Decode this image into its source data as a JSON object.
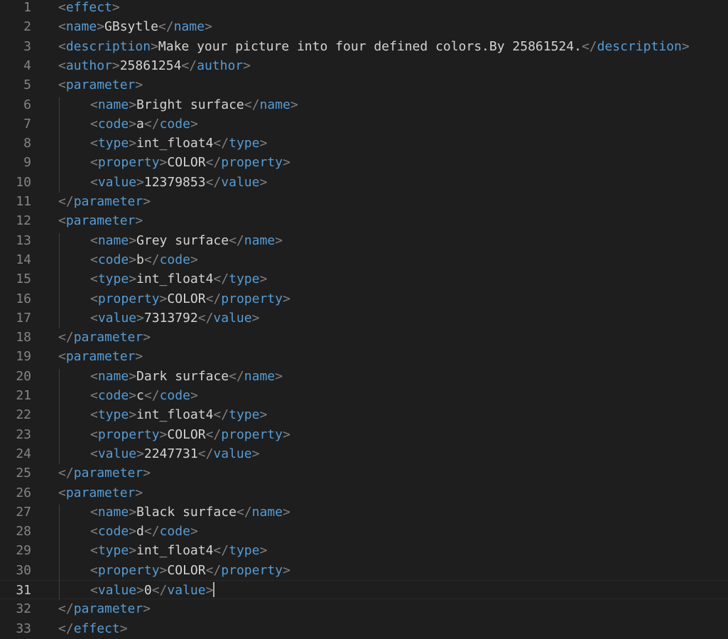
{
  "editor": {
    "language": "xml",
    "cursor_line": 31,
    "colors": {
      "background": "#1e1e1e",
      "tag": "#569cd6",
      "bracket": "#808080",
      "text": "#d4d4d4",
      "line_number": "#858585",
      "active_line_number": "#c6c6c6"
    },
    "lines": [
      {
        "n": "1",
        "indent": 0,
        "tag": "effect"
      },
      {
        "n": "2",
        "indent": 0,
        "tag": "name",
        "text": "GBsytle"
      },
      {
        "n": "3",
        "indent": 0,
        "tag": "description",
        "text": "Make your picture into four defined colors.By 25861524."
      },
      {
        "n": "4",
        "indent": 0,
        "tag": "author",
        "text": "25861254"
      },
      {
        "n": "5",
        "indent": 0,
        "tag": "parameter"
      },
      {
        "n": "6",
        "indent": 1,
        "tag": "name",
        "text": "Bright surface"
      },
      {
        "n": "7",
        "indent": 1,
        "tag": "code",
        "text": "a"
      },
      {
        "n": "8",
        "indent": 1,
        "tag": "type",
        "text": "int_float4"
      },
      {
        "n": "9",
        "indent": 1,
        "tag": "property",
        "text": "COLOR"
      },
      {
        "n": "10",
        "indent": 1,
        "tag": "value",
        "text": "12379853"
      },
      {
        "n": "11",
        "indent": 0,
        "tag": "/parameter"
      },
      {
        "n": "12",
        "indent": 0,
        "tag": "parameter"
      },
      {
        "n": "13",
        "indent": 1,
        "tag": "name",
        "text": "Grey surface"
      },
      {
        "n": "14",
        "indent": 1,
        "tag": "code",
        "text": "b"
      },
      {
        "n": "15",
        "indent": 1,
        "tag": "type",
        "text": "int_float4"
      },
      {
        "n": "16",
        "indent": 1,
        "tag": "property",
        "text": "COLOR"
      },
      {
        "n": "17",
        "indent": 1,
        "tag": "value",
        "text": "7313792"
      },
      {
        "n": "18",
        "indent": 0,
        "tag": "/parameter"
      },
      {
        "n": "19",
        "indent": 0,
        "tag": "parameter"
      },
      {
        "n": "20",
        "indent": 1,
        "tag": "name",
        "text": "Dark surface"
      },
      {
        "n": "21",
        "indent": 1,
        "tag": "code",
        "text": "c"
      },
      {
        "n": "22",
        "indent": 1,
        "tag": "type",
        "text": "int_float4"
      },
      {
        "n": "23",
        "indent": 1,
        "tag": "property",
        "text": "COLOR"
      },
      {
        "n": "24",
        "indent": 1,
        "tag": "value",
        "text": "2247731"
      },
      {
        "n": "25",
        "indent": 0,
        "tag": "/parameter"
      },
      {
        "n": "26",
        "indent": 0,
        "tag": "parameter"
      },
      {
        "n": "27",
        "indent": 1,
        "tag": "name",
        "text": "Black surface"
      },
      {
        "n": "28",
        "indent": 1,
        "tag": "code",
        "text": "d"
      },
      {
        "n": "29",
        "indent": 1,
        "tag": "type",
        "text": "int_float4"
      },
      {
        "n": "30",
        "indent": 1,
        "tag": "property",
        "text": "COLOR"
      },
      {
        "n": "31",
        "indent": 1,
        "tag": "value",
        "text": "0"
      },
      {
        "n": "32",
        "indent": 0,
        "tag": "/parameter"
      },
      {
        "n": "33",
        "indent": 0,
        "tag": "/effect"
      }
    ]
  }
}
